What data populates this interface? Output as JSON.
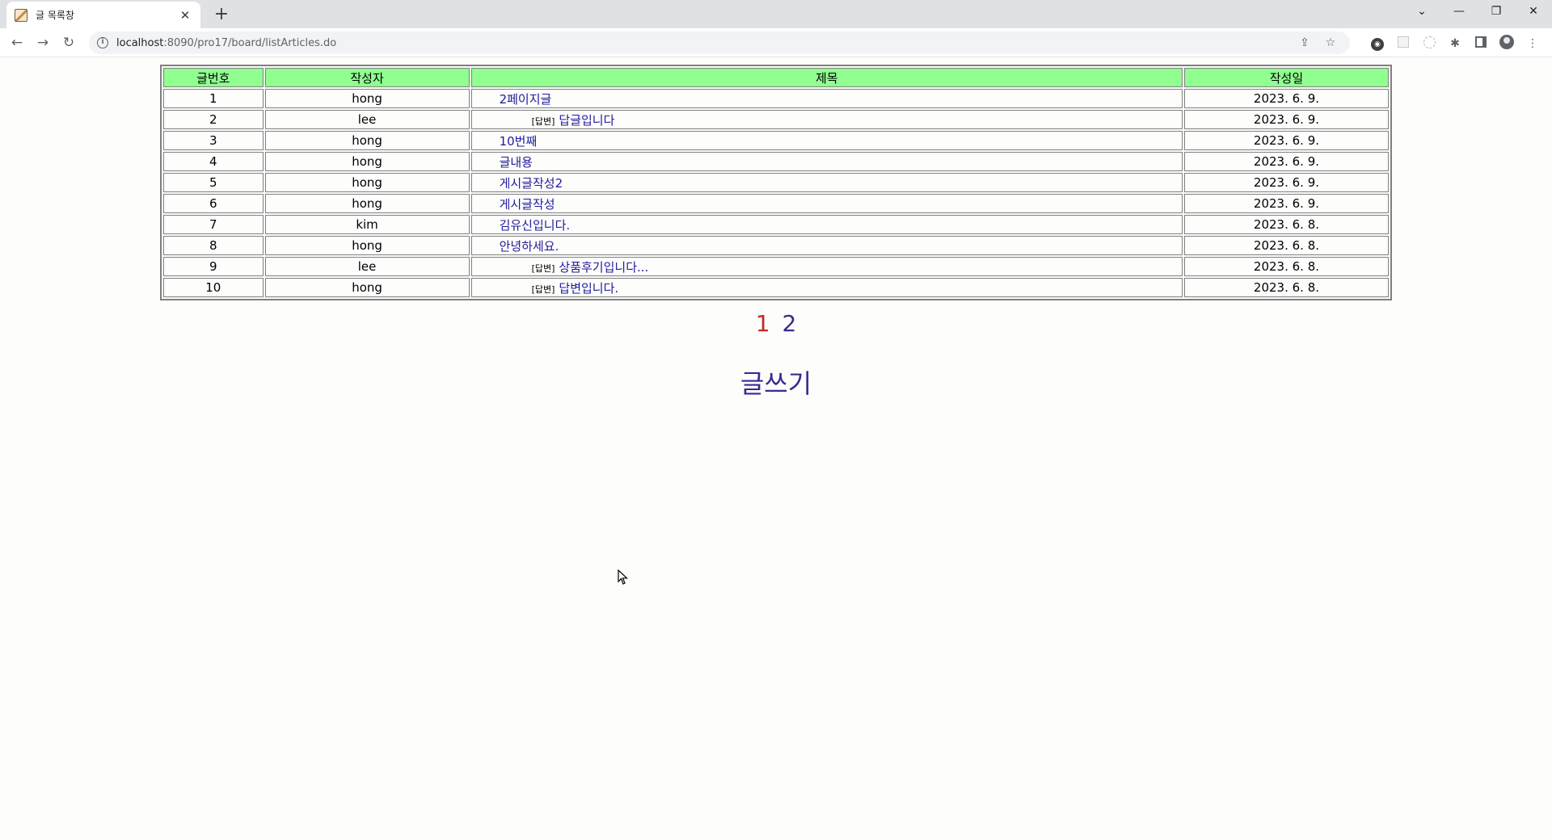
{
  "browser": {
    "tab_title": "글 목록창",
    "url_host": "localhost",
    "url_path": ":8090/pro17/board/listArticles.do"
  },
  "table": {
    "headers": [
      "글번호",
      "작성자",
      "제목",
      "작성일"
    ],
    "rows": [
      {
        "no": "1",
        "writer": "hong",
        "reply": false,
        "reply_tag": "",
        "title": "2페이지글",
        "date": "2023. 6. 9."
      },
      {
        "no": "2",
        "writer": "lee",
        "reply": true,
        "reply_tag": "[답변]",
        "title": "답글입니다",
        "date": "2023. 6. 9."
      },
      {
        "no": "3",
        "writer": "hong",
        "reply": false,
        "reply_tag": "",
        "title": "10번째",
        "date": "2023. 6. 9."
      },
      {
        "no": "4",
        "writer": "hong",
        "reply": false,
        "reply_tag": "",
        "title": "글내용",
        "date": "2023. 6. 9."
      },
      {
        "no": "5",
        "writer": "hong",
        "reply": false,
        "reply_tag": "",
        "title": "게시글작성2",
        "date": "2023. 6. 9."
      },
      {
        "no": "6",
        "writer": "hong",
        "reply": false,
        "reply_tag": "",
        "title": "게시글작성",
        "date": "2023. 6. 9."
      },
      {
        "no": "7",
        "writer": "kim",
        "reply": false,
        "reply_tag": "",
        "title": "김유신입니다.",
        "date": "2023. 6. 8."
      },
      {
        "no": "8",
        "writer": "hong",
        "reply": false,
        "reply_tag": "",
        "title": "안녕하세요.",
        "date": "2023. 6. 8."
      },
      {
        "no": "9",
        "writer": "lee",
        "reply": true,
        "reply_tag": "[답변]",
        "title": "상품후기입니다...",
        "date": "2023. 6. 8."
      },
      {
        "no": "10",
        "writer": "hong",
        "reply": true,
        "reply_tag": "[답변]",
        "title": "답변입니다.",
        "date": "2023. 6. 8."
      }
    ]
  },
  "pagination": {
    "pages": [
      "1",
      "2"
    ],
    "current": "1"
  },
  "write_link": "글쓰기",
  "colors": {
    "header_bg": "#90ff90",
    "link": "#1f1b9a",
    "current_page": "#c4282a"
  }
}
